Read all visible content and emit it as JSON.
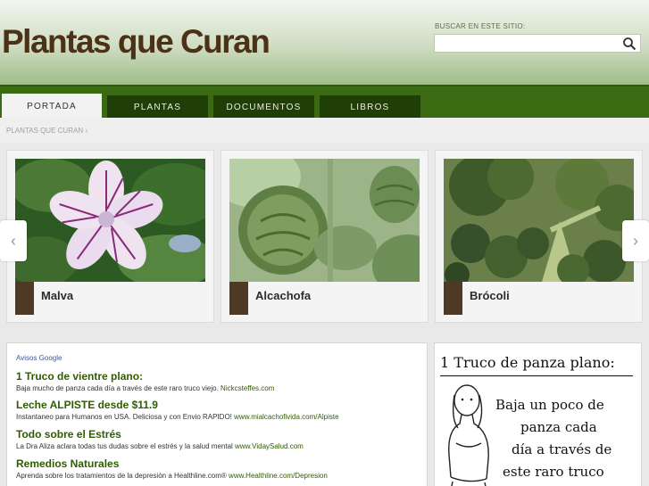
{
  "header": {
    "site_title": "Plantas que Curan",
    "search_label": "BUSCAR EN ESTE SITIO:",
    "search_value": "",
    "search_icon": "magnifier-icon"
  },
  "nav": {
    "tabs": [
      {
        "label": "PORTADA",
        "active": true
      },
      {
        "label": "PLANTAS",
        "active": false
      },
      {
        "label": "DOCUMENTOS",
        "active": false
      },
      {
        "label": "LIBROS",
        "active": false
      }
    ]
  },
  "breadcrumb": {
    "text": "PLANTAS QUE CURAN",
    "separator": "›"
  },
  "carousel": {
    "prev_icon": "chevron-left-icon",
    "next_icon": "chevron-right-icon",
    "items": [
      {
        "label": "Malva"
      },
      {
        "label": "Alcachofa"
      },
      {
        "label": "Brócoli"
      }
    ]
  },
  "ads": {
    "heading": "Avisos Google",
    "items": [
      {
        "title": "1 Truco de vientre plano:",
        "desc": "Baja mucho de panza cada día a través de este raro truco viejo.",
        "url": "Nickcsteffes.com"
      },
      {
        "title": "Leche ALPISTE desde $11.9",
        "desc": "Instantaneo para Humanos en USA. Deliciosa y con Envio RAPIDO!",
        "url": "www.mialcachofivida.com/Alpiste"
      },
      {
        "title": "Todo sobre el Estrés",
        "desc": "La Dra Aliza aclara todas tus dudas sobre el estrés y la salud mental",
        "url": "www.VidaySalud.com"
      },
      {
        "title": "Remedios Naturales",
        "desc": "Aprenda sobre los tratamientos de la depresión a Healthline.com®",
        "url": "www.Healthline.com/Depresion"
      }
    ]
  },
  "promo": {
    "title": "1 Truco de panza plano:",
    "lines": [
      "Baja un poco de",
      "panza cada",
      "día a través de",
      "este raro truco"
    ]
  },
  "colors": {
    "nav_green": "#3a6a12",
    "tab_dark": "#1f3f06",
    "title_brown": "#4b3216",
    "ad_green": "#2f5c00"
  }
}
